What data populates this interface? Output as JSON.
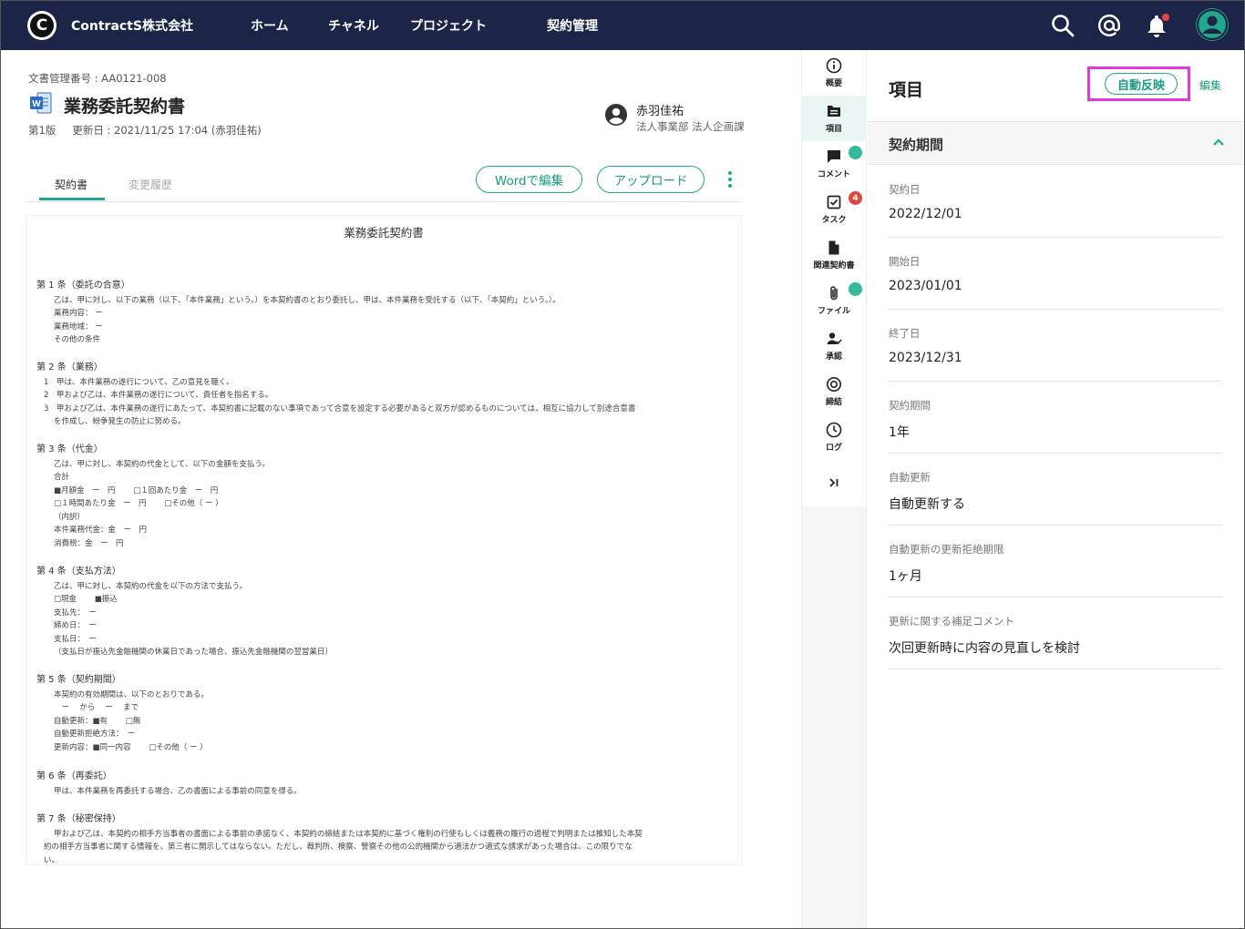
{
  "header": {
    "logo_letter": "C",
    "company": "ContractS株式会社",
    "nav": [
      "ホーム",
      "チャネル",
      "プロジェクト",
      "契約管理"
    ],
    "icons": [
      "search-icon",
      "mention-icon",
      "bell-icon",
      "user-avatar"
    ]
  },
  "document": {
    "number": "文書管理番号 : AA0121-008",
    "title": "業務委託契約書",
    "version": "第1版",
    "updated": "更新日 : 2021/11/25 17:04 (赤羽佳祐)",
    "owner_name": "赤羽佳祐",
    "owner_dept": "法人事業部 法人企画課",
    "tabs": [
      "契約書",
      "変更履歴"
    ],
    "buttons": {
      "word_edit": "Wordで編集",
      "upload": "アップロード"
    }
  },
  "paper": {
    "title": "業務委託契約書",
    "articles": [
      {
        "heading": "第 1 条（委託の合意）",
        "lines": [
          "乙は、甲に対し、以下の業務（以下、「本件業務」という。）を本契約書のとおり委託し、甲は、本件業務を受託する（以下、「本契約」という。）。",
          "業務内容： ー",
          "業務地域： ー",
          "その他の条件"
        ]
      },
      {
        "heading": "第 2 条（業務）",
        "lines": [
          "1　甲は、本件業務の遂行について、乙の意見を聴く。",
          "2　甲および乙は、本件業務の遂行について、責任者を指名する。",
          "3　甲および乙は、本件業務の遂行にあたって、本契約書に記載のない事項であって合意を設定する必要があると双方が認めるものについては、相互に協力して別途合意書",
          "を作成し、紛争発生の防止に努める。"
        ]
      },
      {
        "heading": "第 3 条（代金）",
        "lines": [
          "乙は、甲に対し、本契約の代金として、以下の金額を支払う。",
          "合計",
          "■月額金　ー　円　　 □１回あたり金　ー　円",
          "□１時間あたり金　ー　円　　 □その他（ ー ）",
          "（内訳）",
          "本件業務代金：金　ー　円",
          "消費税：金　ー　円"
        ]
      },
      {
        "heading": "第 4 条（支払方法）",
        "lines": [
          "乙は、甲に対し、本契約の代金を以下の方法で支払う。",
          "□現金　　 ■振込",
          "支払先：　ー",
          "締め日：　ー",
          "支払日：　ー",
          "（支払日が振込先金融機関の休業日であった場合、振込先金融機関の翌営業日）"
        ]
      },
      {
        "heading": "第 5 条（契約期間）",
        "lines": [
          "本契約の有効期間は、以下のとおりである。",
          "　ー　 から　 ー　 まで",
          "自動更新：■有　　 □無",
          "自動更新拒絶方法：　ー",
          "更新内容：■同一内容　　 □その他（ ー ）"
        ]
      },
      {
        "heading": "第 6 条（再委託）",
        "lines": [
          "甲は、本件業務を再委託する場合、乙の書面による事前の同意を得る。"
        ]
      },
      {
        "heading": "第 7 条（秘密保持）",
        "lines": [
          "甲および乙は、本契約の相手方当事者の書面による事前の承諾なく、本契約の締結または本契約に基づく権利の行使もしくは義務の履行の過程で判明または推知した本契",
          "約の相手方当事者に関する情報を、第三者に開示してはならない。ただし、裁判所、検察、警察その他の公的機関から適法かつ適式な請求があった場合は、この限りでな",
          "い。"
        ]
      }
    ]
  },
  "rail": [
    {
      "label": "概要",
      "icon": "info-icon"
    },
    {
      "label": "項目",
      "icon": "fields-icon",
      "active": true
    },
    {
      "label": "コメント",
      "icon": "comment-icon",
      "dot": true
    },
    {
      "label": "タスク",
      "icon": "task-icon",
      "badge": "4"
    },
    {
      "label": "関連契約書",
      "icon": "document-icon"
    },
    {
      "label": "ファイル",
      "icon": "paperclip-icon",
      "dot": true
    },
    {
      "label": "承認",
      "icon": "approve-icon"
    },
    {
      "label": "締結",
      "icon": "seal-icon"
    },
    {
      "label": "ログ",
      "icon": "clock-icon"
    },
    {
      "label": "",
      "icon": "collapse-icon"
    }
  ],
  "panel": {
    "title": "項目",
    "auto_reflect": "自動反映",
    "edit": "編集",
    "section": "契約期間",
    "fields": [
      {
        "label": "契約日",
        "value": "2022/12/01"
      },
      {
        "label": "開始日",
        "value": "2023/01/01"
      },
      {
        "label": "終了日",
        "value": "2023/12/31"
      },
      {
        "label": "契約期間",
        "value": "1年"
      },
      {
        "label": "自動更新",
        "value": "自動更新する"
      },
      {
        "label": "自動更新の更新拒絶期限",
        "value": "1ヶ月"
      },
      {
        "label": "更新に関する補足コメント",
        "value": "次回更新時に内容の見直しを検討"
      }
    ]
  },
  "colors": {
    "topbar": "#1c2547",
    "accent": "#1fa88c",
    "highlight": "#e535e5",
    "badge": "#e0473e"
  }
}
